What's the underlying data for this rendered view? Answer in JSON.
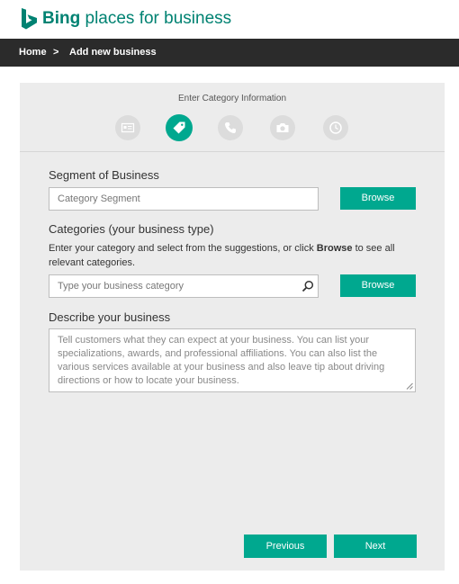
{
  "header": {
    "brand_bold": "Bing",
    "brand_rest": " places for business",
    "logo_icon": "bing-b-logo",
    "brand_color": "#008272"
  },
  "breadcrumb": {
    "home": "Home",
    "separator": ">",
    "current": "Add new business"
  },
  "stepper": {
    "title": "Enter Category Information",
    "steps": [
      {
        "icon": "id-card-icon",
        "active": false
      },
      {
        "icon": "tag-icon",
        "active": true
      },
      {
        "icon": "phone-icon",
        "active": false
      },
      {
        "icon": "camera-icon",
        "active": false
      },
      {
        "icon": "clock-icon",
        "active": false
      }
    ],
    "active_color": "#00a88f",
    "inactive_color": "#dcdcdc"
  },
  "form": {
    "segment": {
      "label": "Segment of Business",
      "placeholder": "Category Segment",
      "value": "",
      "browse_label": "Browse"
    },
    "categories": {
      "label": "Categories (your business type)",
      "help_before": "Enter your category and select from the suggestions, or click ",
      "help_bold": "Browse",
      "help_after": " to see all relevant categories.",
      "placeholder": "Type your business category",
      "value": "",
      "browse_label": "Browse"
    },
    "description": {
      "label": "Describe your business",
      "placeholder": "Tell customers what they can expect at your business. You can list your specializations, awards, and professional affiliations. You can also list the various services available at your business and also leave tip about driving directions or how to locate your business.",
      "value": ""
    }
  },
  "footer": {
    "previous_label": "Previous",
    "next_label": "Next"
  },
  "colors": {
    "accent": "#00a88f",
    "navbar": "#2b2b2b",
    "panel": "#ececec"
  }
}
